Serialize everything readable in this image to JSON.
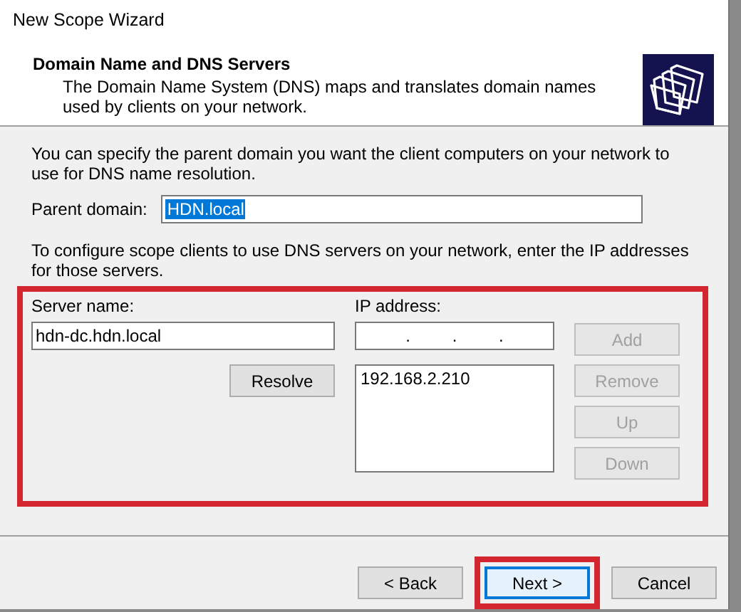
{
  "window": {
    "title": "New Scope Wizard"
  },
  "header": {
    "title": "Domain Name and DNS Servers",
    "description": "The Domain Name System (DNS) maps and translates domain names used by clients on your network."
  },
  "intro": "You can specify the parent domain you want the client computers on your network to use for DNS name resolution.",
  "parent_domain": {
    "label": "Parent domain:",
    "value": "HDN.local",
    "selected": true
  },
  "servers_intro": "To configure scope clients to use DNS servers on your network, enter the IP addresses for those servers.",
  "server_name": {
    "label": "Server name:",
    "value": "hdn-dc.hdn.local"
  },
  "resolve_button": {
    "label": "Resolve",
    "disabled": false
  },
  "ip_address": {
    "label": "IP address:",
    "separators": [
      ".",
      ".",
      "."
    ]
  },
  "ip_list": [
    {
      "text": "192.168.2.210",
      "selected": false
    }
  ],
  "side_buttons": [
    {
      "label": "Add",
      "disabled": true
    },
    {
      "label": "Remove",
      "disabled": true
    },
    {
      "label": "Up",
      "disabled": true
    },
    {
      "label": "Down",
      "disabled": true
    }
  ],
  "footer_buttons": [
    {
      "label": "< Back",
      "disabled": false,
      "default": false,
      "highlighted": false
    },
    {
      "label": "Next >",
      "disabled": false,
      "default": true,
      "highlighted": true
    },
    {
      "label": "Cancel",
      "disabled": false,
      "default": false,
      "highlighted": false
    }
  ]
}
